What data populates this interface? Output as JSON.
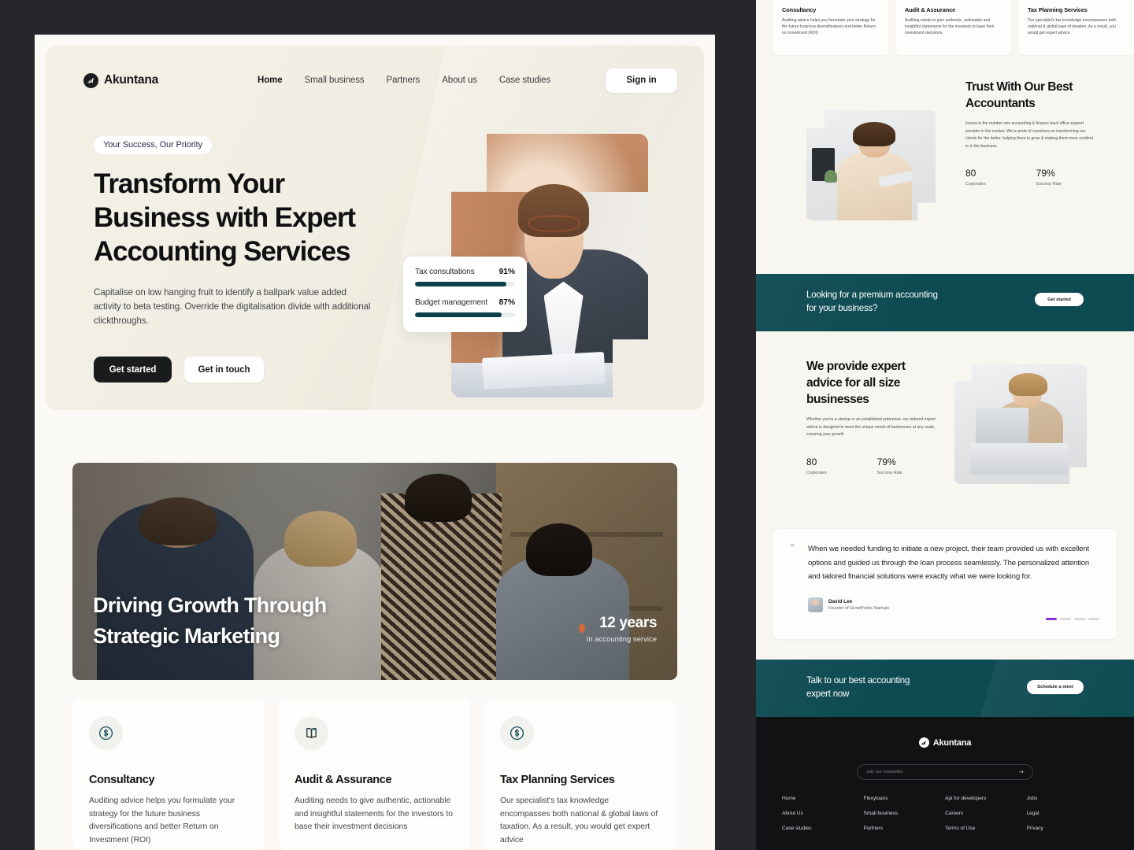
{
  "brand": {
    "name": "Akuntana",
    "logo_icon": "chart-swoosh-icon"
  },
  "nav": {
    "links": [
      {
        "label": "Home",
        "active": true
      },
      {
        "label": "Small business",
        "active": false
      },
      {
        "label": "Partners",
        "active": false
      },
      {
        "label": "About us",
        "active": false
      },
      {
        "label": "Case studies",
        "active": false
      }
    ],
    "signin_label": "Sign in"
  },
  "hero": {
    "eyebrow": "Your Success, Our Priority",
    "title_lines": [
      "Transform Your",
      "Business with Expert",
      "Accounting Services"
    ],
    "subtitle": "Capitalise on low hanging fruit to identify a ballpark value added activity to beta testing. Override the digitalisation divide with additional clickthroughs.",
    "primary_btn": "Get started",
    "secondary_btn": "Get in touch",
    "stats": [
      {
        "label": "Tax consultations",
        "value": "91%",
        "pct": 91
      },
      {
        "label": "Budget management",
        "value": "87%",
        "pct": 87
      }
    ]
  },
  "banner": {
    "title_lines": [
      "Driving Growth Through",
      "Strategic Marketing"
    ],
    "years": "12 years",
    "years_sub": "In accounting service"
  },
  "services": [
    {
      "icon": "dollar-circle-icon",
      "title": "Consultancy",
      "body": "Auditing advice helps you formulate your strategy for the future business diversifications and better Return on Investment (ROI)"
    },
    {
      "icon": "open-book-icon",
      "title": "Audit & Assurance",
      "body": "Auditing needs to give authentic, actionable and insightful statements for the investors to base their investment decisions"
    },
    {
      "icon": "dollar-circle-icon",
      "title": "Tax Planning Services",
      "body": "Our specialist's tax knowledge encompasses both national & global laws of taxation. As a result, you would get expert advice"
    }
  ],
  "trust": {
    "title_lines": [
      "Trust With Our Best",
      "Accountants"
    ],
    "body": "Invesa is the number one accounting & finance back office support provider in the market. We're pride of ourselves on transforming our clients for the better, helping them to grow & making them more resilient to in the business",
    "stats": [
      {
        "num": "80",
        "label": "Corporates"
      },
      {
        "num": "79%",
        "label": "Success Rate"
      }
    ]
  },
  "cta_band": {
    "text_lines": [
      "Looking for a premium accounting",
      "for your business?"
    ],
    "button": "Get started"
  },
  "expert": {
    "title_lines": [
      "We provide expert",
      "advice for all size",
      "businesses"
    ],
    "body": "Whether you're a startup or an established enterprise, our tailored expert advice is designed to meet the unique needs of businesses at any scale, ensuring your growth",
    "stats": [
      {
        "num": "80",
        "label": "Corporates"
      },
      {
        "num": "79%",
        "label": "Success Rate"
      }
    ]
  },
  "testimonial": {
    "quote": "When we needed funding to initiate a new project, their team provided us with excellent options and guided us through the loan process seamlessly. The personalized attention and tailored financial solutions were exactly what we were looking for.",
    "author_name": "David Lee",
    "author_role": "Founder of GrowthVista Startups"
  },
  "cta_band2": {
    "text_lines": [
      "Talk to our best accounting",
      "expert now"
    ],
    "button": "Schedule a meet"
  },
  "footer": {
    "brand": "Akuntana",
    "newsletter_placeholder": "Join our newsletter",
    "newsletter_value": "",
    "columns": [
      [
        "Home",
        "About Us",
        "Case studies"
      ],
      [
        "Flexyloans",
        "Small business",
        "Partners"
      ],
      [
        "Api for developers",
        "Careers",
        "Terms of Use"
      ],
      [
        "Jobs",
        "Legal",
        "Privacy"
      ]
    ]
  },
  "colors": {
    "page_bg": "#faf9f5",
    "canvas_bg": "#26272b",
    "hero_bg": "#f1eee3",
    "teal": "#0d4a52",
    "dark": "#1a1b1d",
    "footer_bg": "#111214",
    "accent_purple": "#8b2fd6"
  }
}
